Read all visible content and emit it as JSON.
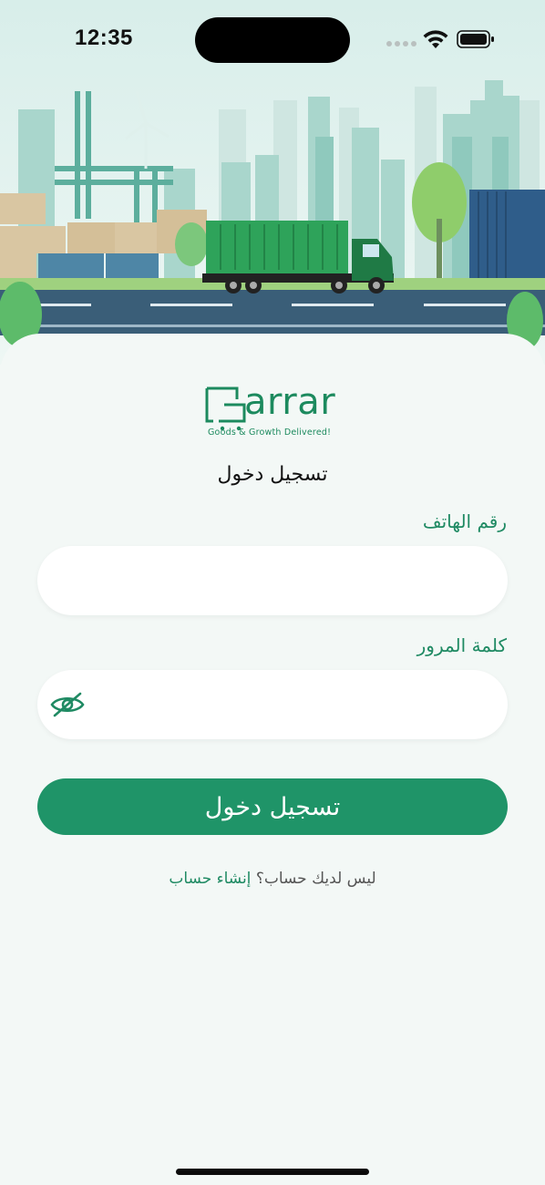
{
  "status_bar": {
    "time": "12:35"
  },
  "brand": {
    "name": "arrar",
    "tagline": "Goods & Growth Delivered!"
  },
  "login": {
    "title": "تسجيل دخول",
    "phone_label": "رقم الهاتف",
    "phone_value": "",
    "password_label": "كلمة المرور",
    "password_value": "",
    "submit_label": "تسجيل دخول",
    "no_account_text": "ليس لديك حساب؟",
    "signup_link": "إنشاء حساب"
  },
  "colors": {
    "primary": "#1f9468",
    "label_green": "#1f8a63",
    "background": "#f3f8f6",
    "input_bg": "#ffffff"
  },
  "icons": {
    "password_toggle": "eye-slash-icon",
    "status": [
      "cellular-icon",
      "wifi-icon",
      "battery-icon"
    ]
  }
}
